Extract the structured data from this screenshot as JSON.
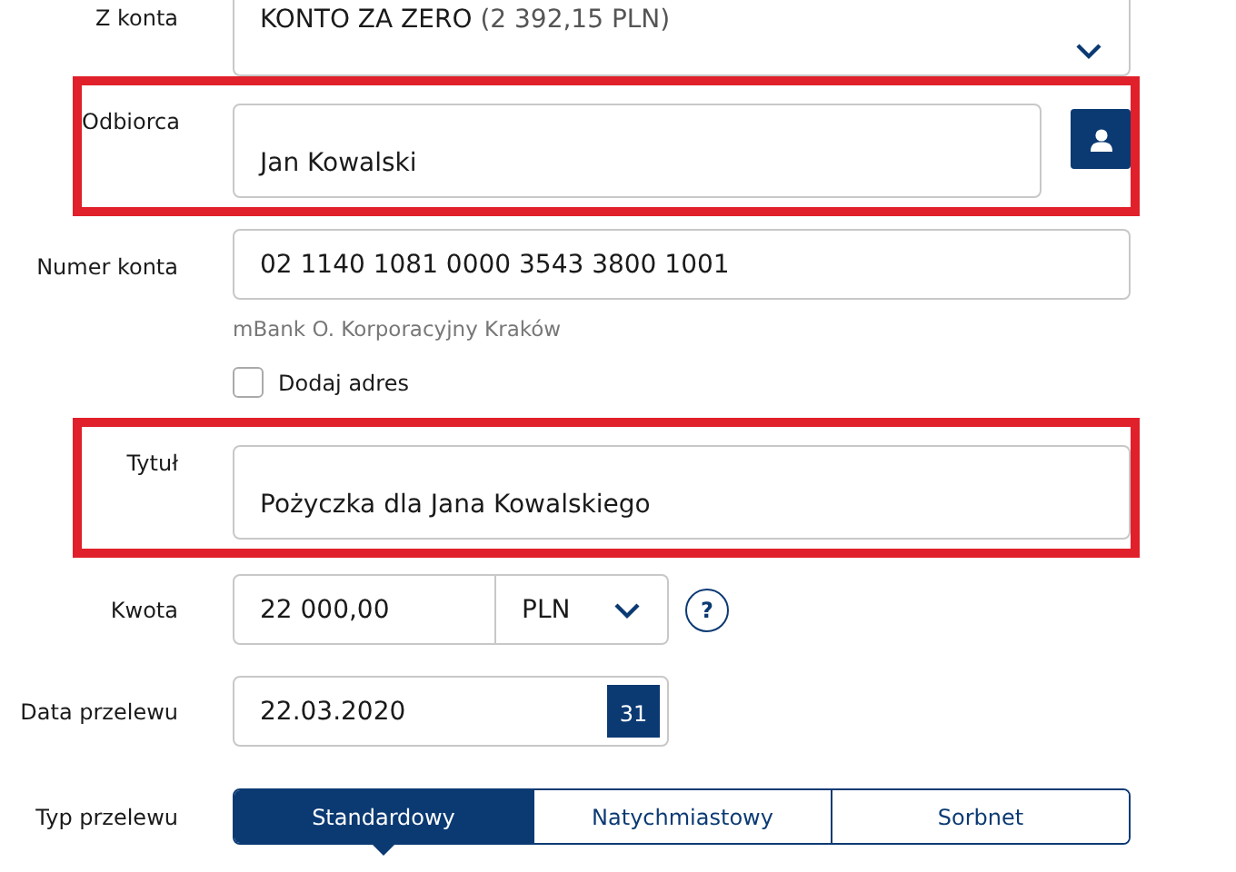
{
  "fields": [
    {
      "kind": "select",
      "label": "Z konta",
      "value": "KONTO ZA ZERO",
      "note": "(2 392,15 PLN)",
      "highlighted": false
    },
    {
      "kind": "recipient",
      "label": "Odbiorca",
      "value": "Jan Kowalski",
      "highlighted": true
    },
    {
      "kind": "text",
      "label": "Numer konta",
      "value": "02 1140 1081 0000 3543 3800 1001",
      "hint": "mBank O. Korporacyjny Kraków",
      "highlighted": false
    },
    {
      "kind": "checkbox",
      "label": "Dodaj adres",
      "checked": false,
      "highlighted": false
    },
    {
      "kind": "tall",
      "label": "Tytuł",
      "value": "Pożyczka dla Jana Kowalskiego",
      "highlighted": true
    },
    {
      "kind": "amount",
      "label": "Kwota",
      "value": "22 000,00",
      "currency": "PLN",
      "help": "?",
      "highlighted": false
    },
    {
      "kind": "date",
      "label": "Data przelewu",
      "value": "22.03.2020",
      "day": "31",
      "highlighted": false
    },
    {
      "kind": "segments",
      "label": "Typ przelewu",
      "highlighted": false,
      "options": [
        {
          "label": "Standardowy",
          "selected": true
        },
        {
          "label": "Natychmiastowy",
          "selected": false
        },
        {
          "label": "Sorbnet",
          "selected": false
        }
      ]
    }
  ]
}
